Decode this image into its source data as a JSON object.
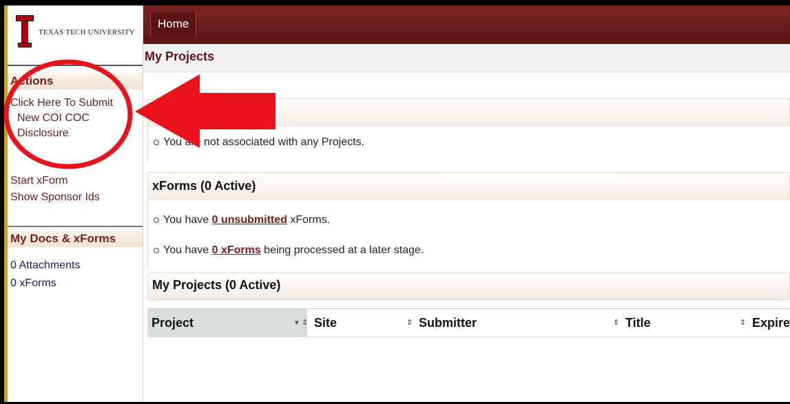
{
  "logo": {
    "name": "Texas Tech University"
  },
  "nav": {
    "home": "Home"
  },
  "page": {
    "title": "My Projects"
  },
  "sidebar": {
    "actions_heading": "Actions",
    "submit_link": [
      "Click Here To Submit",
      "New COI COC",
      "Disclosure"
    ],
    "start_xform": "Start xForm",
    "show_sponsor_ids": "Show Sponsor Ids",
    "docs_heading": "My Docs & xForms",
    "attachments": "0 Attachments",
    "xforms": "0 xForms"
  },
  "projects_notice": "You are not associated with any Projects.",
  "xforms_section": {
    "heading": "xForms (0 Active)",
    "line1_pre": "You have ",
    "line1_link": "0 unsubmitted",
    "line1_post": " xForms.",
    "line2_pre": "You have ",
    "line2_link": "0 xForms",
    "line2_post": " being processed at a later stage."
  },
  "projects_table": {
    "heading": "My Projects (0 Active)",
    "columns": [
      "Project",
      "Site",
      "Submitter",
      "Title",
      "Expires"
    ]
  },
  "colors": {
    "maroon": "#7a1c1c",
    "annotation_red": "#e8131b",
    "gold": "#c9a227"
  },
  "annotation": {
    "icons": [
      "red-circle",
      "red-arrow-left"
    ]
  }
}
